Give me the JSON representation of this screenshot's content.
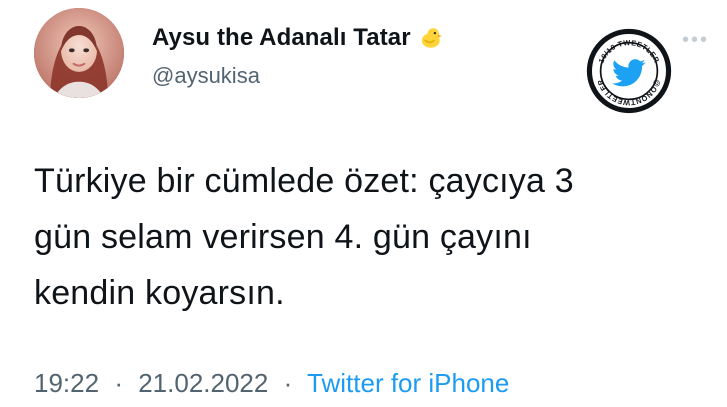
{
  "author": {
    "display_name": "Aysu the Adanalı Tatar",
    "handle": "@aysukisa",
    "name_emoji_icon": "chick-icon"
  },
  "badge": {
    "top_text": "10/10 TWEETLER",
    "bottom_text": "@ONONTWEETLER",
    "icon": "twitter-bird-icon"
  },
  "tweet": {
    "lines": [
      "Türkiye bir cümlede özet: çaycıya 3",
      "gün selam verirsen 4. gün çayını",
      "kendin koyarsın."
    ]
  },
  "meta": {
    "time": "19:22",
    "date": "21.02.2022",
    "separator": "·",
    "source": "Twitter for iPhone"
  },
  "colors": {
    "text": "#0f1419",
    "secondary": "#536471",
    "link": "#1d9bf0",
    "twitter_blue": "#1da1f2"
  }
}
